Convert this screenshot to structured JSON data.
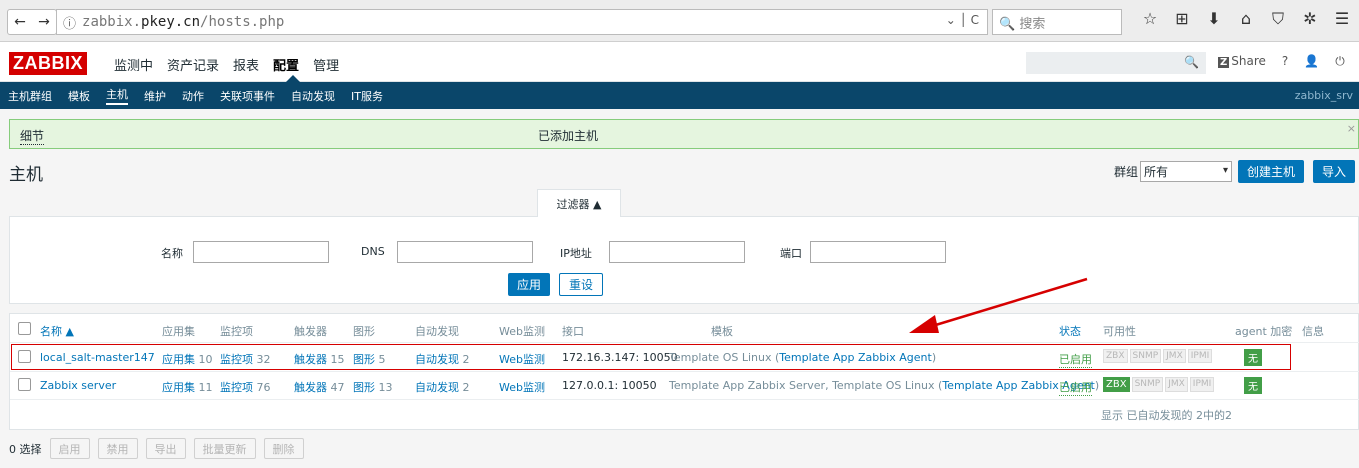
{
  "browser": {
    "nav_back": "←",
    "nav_forward": "→",
    "info_glyph": "ⓘ",
    "url_prefix": "zabbix.",
    "url_domain": "pkey.cn",
    "url_path": "/hosts.php",
    "url_tools": "⌄ │ C",
    "search_placeholder": "🔍 搜索",
    "icons": [
      "star-icon",
      "reader-icon",
      "download-icon",
      "home-icon",
      "pocket-icon",
      "extension-icon",
      "menu-icon"
    ],
    "icon_glyphs": [
      "☆",
      "⊞",
      "⬇",
      "⌂",
      "⛉",
      "✲",
      "☰"
    ]
  },
  "header": {
    "logo": "ZABBIX",
    "menu": [
      "监测中",
      "资产记录",
      "报表",
      "配置",
      "管理"
    ],
    "active_menu": "配置",
    "search_icon": "🔍",
    "share_z": "Z",
    "share_label": "Share",
    "help": "?",
    "user": "👤",
    "logout": "⏻"
  },
  "submenu": {
    "items": [
      "主机群组",
      "模板",
      "主机",
      "维护",
      "动作",
      "关联项事件",
      "自动发现",
      "IT服务"
    ],
    "active": "主机",
    "server_name": "zabbix_srv"
  },
  "message": {
    "details": "细节",
    "text": "已添加主机",
    "close": "×"
  },
  "page": {
    "title": "主机",
    "group_label": "群组",
    "group_value": "所有",
    "create_button": "创建主机",
    "import_button": "导入"
  },
  "filter": {
    "tab_label": "过滤器 ▲",
    "name_label": "名称",
    "dns_label": "DNS",
    "ip_label": "IP地址",
    "port_label": "端口",
    "apply": "应用",
    "reset": "重设"
  },
  "table": {
    "headers": {
      "name": "名称 ▲",
      "apps": "应用集",
      "items": "监控项",
      "triggers": "触发器",
      "graphs": "图形",
      "discovery": "自动发现",
      "web": "Web监测",
      "interface": "接口",
      "templates": "模板",
      "status": "状态",
      "availability": "可用性",
      "encryption": "agent 加密",
      "info": "信息"
    },
    "rows": [
      {
        "name": "local_salt-master147",
        "apps_label": "应用集",
        "apps_count": "10",
        "items_label": "监控项",
        "items_count": "32",
        "triggers_label": "触发器",
        "triggers_count": "15",
        "graphs_label": "图形",
        "graphs_count": "5",
        "discovery_label": "自动发现",
        "discovery_count": "2",
        "web": "Web监测",
        "interface": "172.16.3.147: 10050",
        "template_main": "Template OS Linux",
        "template_open": " (",
        "template_sub": "Template App Zabbix Agent",
        "template_close": ")",
        "status": "已启用",
        "zbx": "ZBX",
        "snmp": "SNMP",
        "jmx": "JMX",
        "ipmi": "IPMI",
        "zbx_on": false,
        "encryption": "无"
      },
      {
        "name": "Zabbix server",
        "apps_label": "应用集",
        "apps_count": "11",
        "items_label": "监控项",
        "items_count": "76",
        "triggers_label": "触发器",
        "triggers_count": "47",
        "graphs_label": "图形",
        "graphs_count": "13",
        "discovery_label": "自动发现",
        "discovery_count": "2",
        "web": "Web监测",
        "interface": "127.0.0.1: 10050",
        "template_pre": "Template App Zabbix Server",
        "template_sep": ", ",
        "template_main": "Template OS Linux",
        "template_open": " (",
        "template_sub": "Template App Zabbix Agent",
        "template_close": ")",
        "status": "已启用",
        "zbx": "ZBX",
        "snmp": "SNMP",
        "jmx": "JMX",
        "ipmi": "IPMI",
        "zbx_on": true,
        "encryption": "无"
      }
    ],
    "footer": "显示 已自动发现的 2中的2"
  },
  "actions": {
    "selected": "0 选择",
    "enable": "启用",
    "disable": "禁用",
    "export": "导出",
    "mass_update": "批量更新",
    "delete": "删除"
  },
  "colors": {
    "brand_red": "#d40000",
    "nav_blue": "#0a466a",
    "link_blue": "#0275b8",
    "success_green": "#429e47",
    "annotation_red": "#d60000"
  }
}
